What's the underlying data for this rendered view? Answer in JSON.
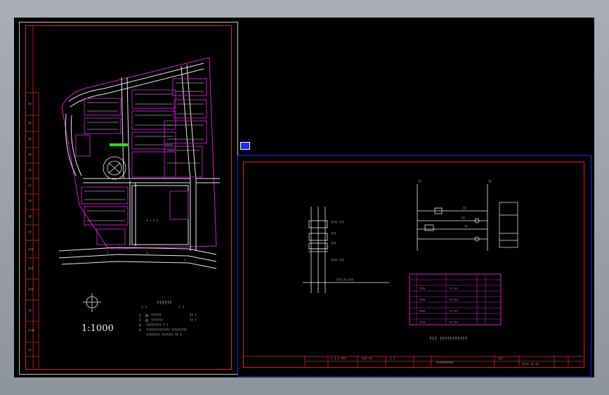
{
  "left_sheet": {
    "scale_label": "1:1000",
    "legend_title": "??????",
    "legend_header": "? ?",
    "legend_rows": [
      {
        "n": "1",
        "text": "??????",
        "v": "?? ?"
      },
      {
        "n": "2",
        "text": "???????",
        "v": "?? ?"
      },
      {
        "n": "3",
        "text": "????????? ? ?"
      },
      {
        "n": "4",
        "text": "?????????????? ?????????"
      },
      {
        "n": "",
        "text": "???????? ??????? ?? ?"
      }
    ],
    "site_note": "? ? ? ?"
  },
  "right_sheet": {
    "circuit_caption": "??? ???????????",
    "labels": {
      "breaker": "??? ???",
      "phase": "???",
      "rating": "???",
      "supply": "??? ??-???",
      "cable": "??? ???"
    },
    "title_block": {
      "cells": [
        "? ?",
        "?",
        "?????",
        "??? ??",
        "?? ??",
        "?",
        "? ?",
        "??????????",
        "???",
        "?"
      ],
      "drawing_no": "???? ??-??"
    }
  },
  "colors": {
    "frame": "#e0202a",
    "roads": "#e8e8e8",
    "buildings": "#d020d0",
    "blocks": "#e8e8e8",
    "highlight": "#20e020",
    "selection": "#1a2cff"
  }
}
